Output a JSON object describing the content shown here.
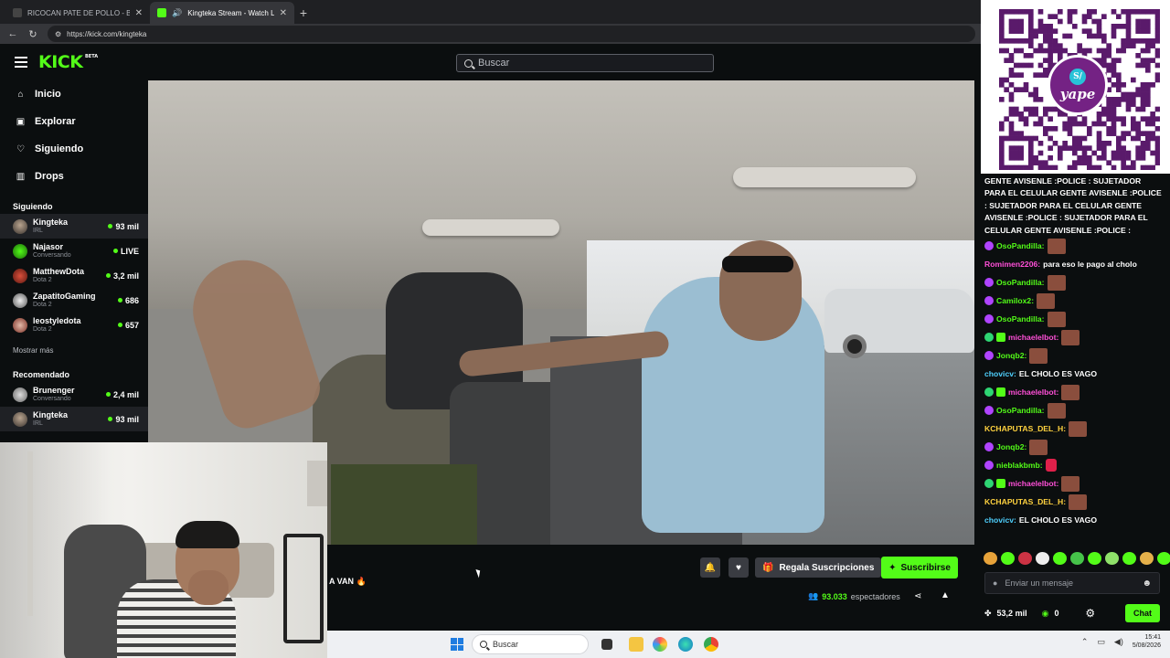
{
  "browser": {
    "tabs": [
      {
        "title": "RICOCAN PATE DE POLLO - Búsqu",
        "active": false
      },
      {
        "title": "Kingteka Stream - Watch Live",
        "active": true
      }
    ],
    "url": "https://kick.com/kingteka"
  },
  "header": {
    "logo": "KICK",
    "logo_tag": "BETA",
    "search_placeholder": "Buscar"
  },
  "nav": [
    {
      "label": "Inicio",
      "icon": "home-icon"
    },
    {
      "label": "Explorar",
      "icon": "compass-icon"
    },
    {
      "label": "Siguiendo",
      "icon": "heart-icon"
    },
    {
      "label": "Drops",
      "icon": "drops-icon"
    }
  ],
  "following": {
    "title": "Siguiendo",
    "channels": [
      {
        "name": "Kingteka",
        "category": "IRL",
        "viewers": "93 mil",
        "active": true
      },
      {
        "name": "Najasor",
        "category": "Conversando",
        "viewers": "LIVE"
      },
      {
        "name": "MatthewDota",
        "category": "Dota 2",
        "viewers": "3,2 mil"
      },
      {
        "name": "ZapatitoGaming",
        "category": "Dota 2",
        "viewers": "686"
      },
      {
        "name": "leostyledota",
        "category": "Dota 2",
        "viewers": "657"
      }
    ],
    "more": "Mostrar más"
  },
  "recommended": {
    "title": "Recomendado",
    "channels": [
      {
        "name": "Brunenger",
        "category": "Conversando",
        "viewers": "2,4 mil"
      },
      {
        "name": "Kingteka",
        "category": "IRL",
        "viewers": "93 mil",
        "active": true
      }
    ]
  },
  "stream": {
    "title_fragment": "A VAN 🔥",
    "gift_label": "Regala Suscripciones",
    "subscribe_label": "Suscribirse",
    "viewers": "93.033",
    "viewers_label": "espectadores"
  },
  "chat": {
    "top_message": "GENTE AVISENLE :POLICE : SUJETADOR PARA EL CELULAR GENTE AVISENLE :POLICE : SUJETADOR PARA EL CELULAR GENTE AVISENLE :POLICE : SUJETADOR PARA EL CELULAR GENTE AVISENLE :POLICE :",
    "messages": [
      {
        "user": "OsoPandilla:",
        "color": "#53fc18",
        "text": "",
        "emote": true,
        "badge": "#b044ff"
      },
      {
        "user": "Romimen2206:",
        "color": "#ff4fd8",
        "text": "para eso le pago al cholo"
      },
      {
        "user": "OsoPandilla:",
        "color": "#53fc18",
        "text": "",
        "emote": true,
        "badge": "#b044ff"
      },
      {
        "user": "Camilox2:",
        "color": "#53fc18",
        "text": "",
        "emote": true,
        "badge": "#b044ff"
      },
      {
        "user": "OsoPandilla:",
        "color": "#53fc18",
        "text": "",
        "emote": true,
        "badge": "#b044ff"
      },
      {
        "user": "michaelelbot:",
        "color": "#ff4fd8",
        "text": "",
        "emote": true,
        "badge": "#2ed573",
        "badge2": "#53fc18"
      },
      {
        "user": "Jonqb2:",
        "color": "#53fc18",
        "text": "",
        "emote": true,
        "badge": "#b044ff"
      },
      {
        "user": "chovicv:",
        "color": "#4fd1ff",
        "text": "EL CHOLO ES VAGO"
      },
      {
        "user": "michaelelbot:",
        "color": "#ff4fd8",
        "text": "",
        "emote": true,
        "badge": "#2ed573",
        "badge2": "#53fc18"
      },
      {
        "user": "OsoPandilla:",
        "color": "#53fc18",
        "text": "",
        "emote": true,
        "badge": "#b044ff"
      },
      {
        "user": "KCHAPUTAS_DEL_H:",
        "color": "#ffd23f",
        "text": "",
        "emote": true
      },
      {
        "user": "Jonqb2:",
        "color": "#53fc18",
        "text": "",
        "emote": true,
        "badge": "#b044ff"
      },
      {
        "user": "nieblakbmb:",
        "color": "#53fc18",
        "text": "",
        "emote_small": true,
        "badge": "#b044ff"
      },
      {
        "user": "michaelelbot:",
        "color": "#ff4fd8",
        "text": "",
        "emote": true,
        "badge": "#2ed573",
        "badge2": "#53fc18"
      },
      {
        "user": "KCHAPUTAS_DEL_H:",
        "color": "#ffd23f",
        "text": "",
        "emote": true
      },
      {
        "user": "chovicv:",
        "color": "#4fd1ff",
        "text": "EL CHOLO ES VAGO"
      }
    ],
    "input_placeholder": "Enviar un mensaje",
    "points": "53,2 mil",
    "coins": "0",
    "chat_button": "Chat"
  },
  "taskbar": {
    "search": "Buscar",
    "time": "15:41",
    "date": "5/08/2026"
  },
  "qr": {
    "brand": "yape"
  },
  "colors": {
    "kick_green": "#53fc18",
    "bg": "#0b0e0f",
    "yape_purple": "#742284"
  }
}
